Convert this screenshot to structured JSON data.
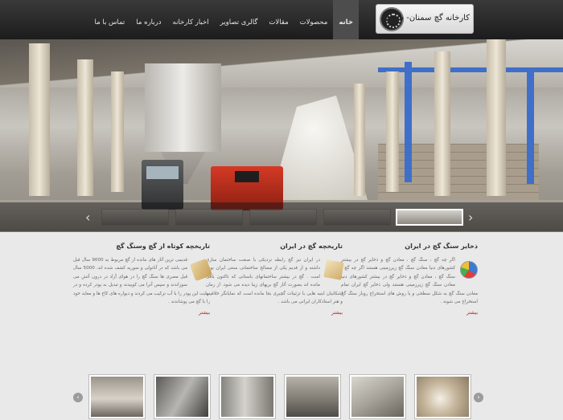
{
  "header": {
    "logo_text": "کارخانه گچ سمنان- ساری",
    "nav": [
      {
        "label": "خانه"
      },
      {
        "label": "محصولات"
      },
      {
        "label": "مقالات"
      },
      {
        "label": "گالری تصاویر"
      },
      {
        "label": "اخبار کارخانه"
      },
      {
        "label": "درباره ما"
      },
      {
        "label": "تماس با ما"
      }
    ]
  },
  "slider": {
    "prev_label": "‹",
    "next_label": "›",
    "active_thumb": 5
  },
  "articles": [
    {
      "title": "ذخایر سنگ گچ در ایران",
      "body": "اگر چه گچ ، سنگ گچ ، معادن گچ و ذخایر گچ در بیشتر کشورهای دنیا معادن سنگ گچ زیرزمینی هستند اگر چه گچ ، سنگ گچ ، معادن گچ و ذخایر گچ در بیشتر کشورهای دنیا معادن سنگ گچ زیرزمینی هستند ولی ذخایر گچ ایران تمام معادن سنگ گچ به شکل سطحی و یا روش های استخراج روباز سنگ گچ استخراج می شوند .",
      "more": "بیشتر",
      "icon": "pie-chart-icon"
    },
    {
      "title": "تاریخچه گچ در ایران",
      "body": "در ایران نیز گچ رابطه نزدیکی با صنعت ساختمان سازی داشته و از قدیم یکی از مصالح ساختمانی سنتی ایران بوده است . گچ در بیشتر ساختمانهای باستانی که تاکنون باقی مانده اند بصورت آثار گچ بریهای زیبا دیده می شود. از زمان اشکانیان ابنیه هایی با تزئینات گچبری بجا مانده است که نمایانگر خلاقیت و هنر استادکاران ایرانی می باشد .",
      "more": "بیشتر",
      "icon": "feather-icon"
    },
    {
      "title": "تاریخچه کوتاه از گچ وسنگ گچ",
      "body": "قدیمی ترین آثار های مانده از گچ مربوط به 9000 سال قبل می باشد که در آناتولی و سوریه کشف شده اند. 5000 سال قبل مصری ها سنگ گچ را در هوای آزاد در درون آتش می سوزاندند و سپس آنرا می کوبیدند و تبدیل به پودر کرده و در نهایت این پودر را با آب ترکیب می کردند و دیواره های کاخ ها و معابد خود را با گچ می پوشاندند .",
      "more": "بیشتر",
      "icon": "scroll-icon"
    }
  ],
  "gallery": {
    "prev_label": "‹",
    "next_label": "›",
    "thumbs": [
      "factory-photo",
      "machinery-photo",
      "pipes-photo",
      "silo-photo",
      "conveyor-photo",
      "lab-sample-photo",
      "lab-test-photo"
    ]
  }
}
